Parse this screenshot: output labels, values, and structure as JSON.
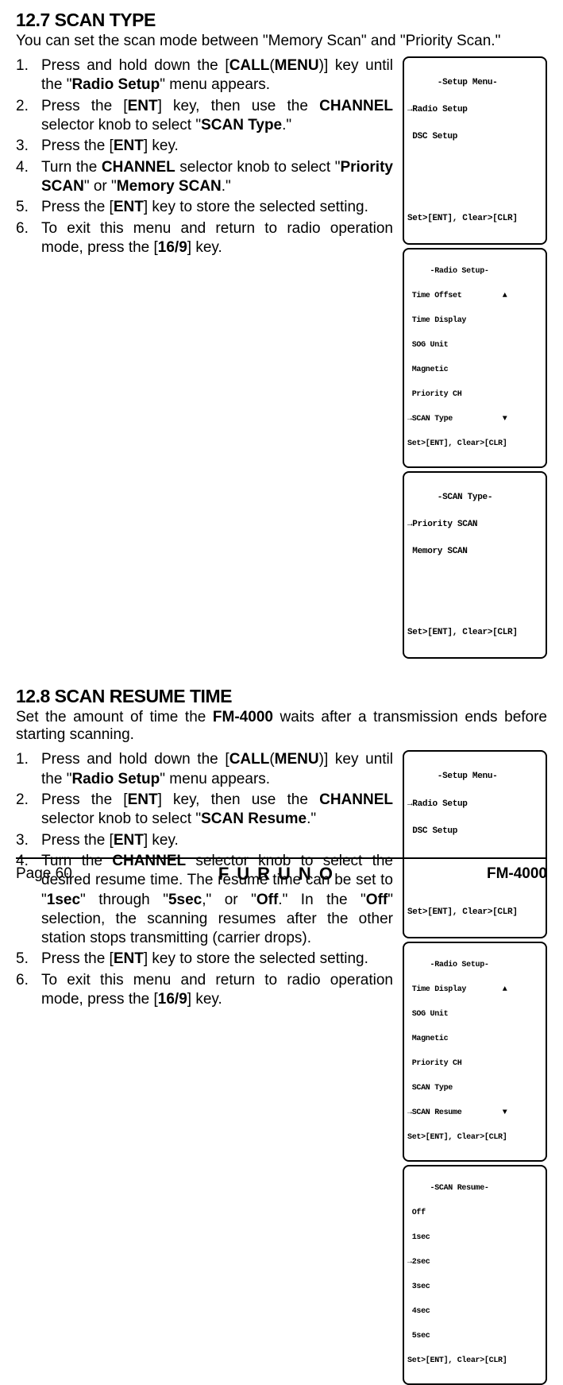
{
  "section1": {
    "header": "12.7   SCAN TYPE",
    "intro": "You can set the scan mode between \"Memory Scan\" and \"Priority Scan.\"",
    "steps": {
      "s1a": "Press and hold down the [",
      "s1b": "CALL",
      "s1c": "(",
      "s1d": "MENU",
      "s1e": ")] key until the \"",
      "s1f": "Radio Setup",
      "s1g": "\" menu appears.",
      "s2a": "Press the [",
      "s2b": "ENT",
      "s2c": "] key, then use the ",
      "s2d": "CHANNEL",
      "s2e": " selector knob to select \"",
      "s2f": "SCAN Type",
      "s2g": ".\"",
      "s3a": "Press the [",
      "s3b": "ENT",
      "s3c": "] key.",
      "s4a": "Turn the ",
      "s4b": "CHANNEL",
      "s4c": " selector knob to select \"",
      "s4d": "Priority SCAN",
      "s4e": "\" or \"",
      "s4f": "Memory SCAN",
      "s4g": ".\"",
      "s5a": "Press the [",
      "s5b": "ENT",
      "s5c": "] key to store the selected setting.",
      "s6a": "To exit this menu and return to radio operation mode, press the [",
      "s6b": "16/9",
      "s6c": "] key."
    },
    "lcd1": {
      "l1": "      -Setup Menu-",
      "l2": "→Radio Setup",
      "l3": " DSC Setup",
      "l4": "",
      "l5": "",
      "l6": "Set>[ENT], Clear>[CLR]"
    },
    "lcd2": {
      "l1": "     -Radio Setup-",
      "l2": " Time Offset         ▲",
      "l3": " Time Display",
      "l4": " SOG Unit",
      "l5": " Magnetic",
      "l6": " Priority CH",
      "l7": "→SCAN Type           ▼",
      "l8": "Set>[ENT], Clear>[CLR]"
    },
    "lcd3": {
      "l1": "      -SCAN Type-",
      "l2": "→Priority SCAN",
      "l3": " Memory SCAN",
      "l4": "",
      "l5": "",
      "l6": "Set>[ENT], Clear>[CLR]"
    }
  },
  "section2": {
    "header": "12.8   SCAN RESUME TIME",
    "intro_a": "Set the amount of time the ",
    "intro_b": "FM-4000",
    "intro_c": " waits after a transmission ends before starting scanning.",
    "steps": {
      "s1a": "Press and hold down the [",
      "s1b": "CALL",
      "s1c": "(",
      "s1d": "MENU",
      "s1e": ")] key until the \"",
      "s1f": "Radio Setup",
      "s1g": "\" menu appears.",
      "s2a": "Press the [",
      "s2b": "ENT",
      "s2c": "] key, then use the ",
      "s2d": "CHANNEL",
      "s2e": " selector knob to select \"",
      "s2f": "SCAN Resume",
      "s2g": ".\"",
      "s3a": "Press the [",
      "s3b": "ENT",
      "s3c": "] key.",
      "s4a": "Turn the ",
      "s4b": "CHANNEL",
      "s4c": " selector knob to select the desired resume time. The resume time can be set to \"",
      "s4d": "1sec",
      "s4e": "\" through \"",
      "s4f": "5sec",
      "s4g": ",\" or \"",
      "s4h": "Off",
      "s4i": ".\" In the \"",
      "s4j": "Off",
      "s4k": "\" selection, the scanning resumes after the other station stops transmitting (carrier drops).",
      "s5a": "Press the [",
      "s5b": "ENT",
      "s5c": "] key to  store the selected setting.",
      "s6a": "To exit this menu and return to radio operation mode, press the [",
      "s6b": "16/9",
      "s6c": "] key."
    },
    "lcd1": {
      "l1": "      -Setup Menu-",
      "l2": "→Radio Setup",
      "l3": " DSC Setup",
      "l4": "",
      "l5": "",
      "l6": "Set>[ENT], Clear>[CLR]"
    },
    "lcd2": {
      "l1": "     -Radio Setup-",
      "l2": " Time Display        ▲",
      "l3": " SOG Unit",
      "l4": " Magnetic",
      "l5": " Priority CH",
      "l6": " SCAN Type",
      "l7": "→SCAN Resume         ▼",
      "l8": "Set>[ENT], Clear>[CLR]"
    },
    "lcd3": {
      "l1": "     -SCAN Resume-",
      "l2": " Off",
      "l3": " 1sec",
      "l4": "→2sec",
      "l5": " 3sec",
      "l6": " 4sec",
      "l7": " 5sec",
      "l8": "Set>[ENT], Clear>[CLR]"
    }
  },
  "footer": {
    "page": "Page 60",
    "brand": "FURUNO",
    "model": "FM-4000"
  }
}
